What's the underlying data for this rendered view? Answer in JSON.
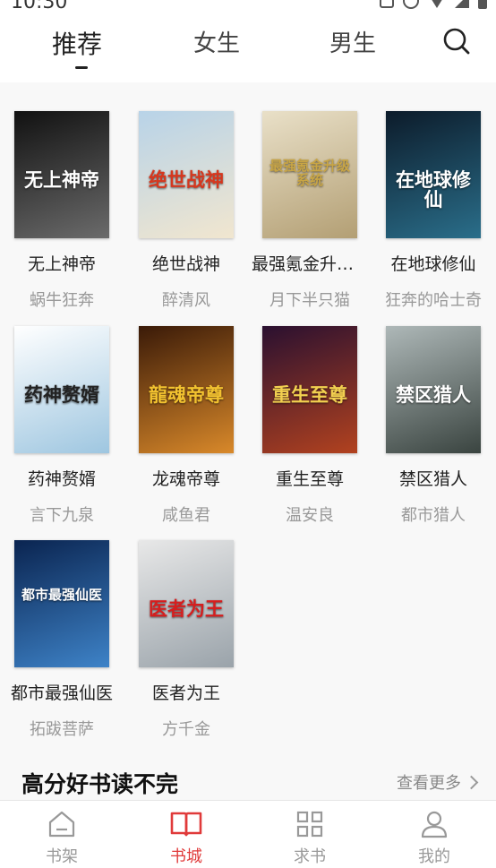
{
  "status": {
    "time": "10:30"
  },
  "tabs": [
    {
      "label": "推荐",
      "active": true
    },
    {
      "label": "女生"
    },
    {
      "label": "男生"
    }
  ],
  "books": [
    {
      "title": "无上神帝",
      "author": "蜗牛狂奔",
      "cover_text": "无上神帝",
      "colors": [
        "#111111",
        "#6b6b6b"
      ],
      "text_color": "#ffffff"
    },
    {
      "title": "绝世战神",
      "author": "醉清风",
      "cover_text": "绝世战神",
      "colors": [
        "#b8d3e8",
        "#f1e6cf"
      ],
      "text_color": "#d6371e"
    },
    {
      "title": "最强氪金升级...",
      "author": "月下半只猫",
      "cover_text": "最强氪金升级系统",
      "colors": [
        "#e9e0c8",
        "#b39f74"
      ],
      "text_color": "#c8a545"
    },
    {
      "title": "在地球修仙",
      "author": "狂奔的哈士奇",
      "cover_text": "在地球修仙",
      "colors": [
        "#0c1b2a",
        "#2a6e8a"
      ],
      "text_color": "#ffffff"
    },
    {
      "title": "药神赘婿",
      "author": "言下九泉",
      "cover_text": "药神赘婿",
      "colors": [
        "#ffffff",
        "#9ec6e0"
      ],
      "text_color": "#222222"
    },
    {
      "title": "龙魂帝尊",
      "author": "咸鱼君",
      "cover_text": "龍魂帝尊",
      "colors": [
        "#3a1a08",
        "#d9892a"
      ],
      "text_color": "#f2c230"
    },
    {
      "title": "重生至尊",
      "author": "温安良",
      "cover_text": "重生至尊",
      "colors": [
        "#2a1030",
        "#b2421f"
      ],
      "text_color": "#f2d050"
    },
    {
      "title": "禁区猎人",
      "author": "都市猎人",
      "cover_text": "禁区猎人",
      "colors": [
        "#aeb8b8",
        "#3a4440"
      ],
      "text_color": "#ffffff"
    },
    {
      "title": "都市最强仙医",
      "author": "拓跋菩萨",
      "cover_text": "都市最强仙医",
      "colors": [
        "#0a2450",
        "#3e83c8"
      ],
      "text_color": "#ffffff"
    },
    {
      "title": "医者为王",
      "author": "方千金",
      "cover_text": "医者为王",
      "colors": [
        "#e8e8e8",
        "#9aa3aa"
      ],
      "text_color": "#d61e1e"
    }
  ],
  "section": {
    "title": "高分好书读不完",
    "more": "查看更多"
  },
  "bottom_nav": [
    {
      "label": "书架",
      "icon": "bookshelf-icon"
    },
    {
      "label": "书城",
      "icon": "bookstore-icon",
      "active": true
    },
    {
      "label": "求书",
      "icon": "grid-icon"
    },
    {
      "label": "我的",
      "icon": "profile-icon"
    }
  ],
  "colors": {
    "accent": "#e03a3a",
    "muted": "#999999",
    "background": "#f8f8f8"
  }
}
